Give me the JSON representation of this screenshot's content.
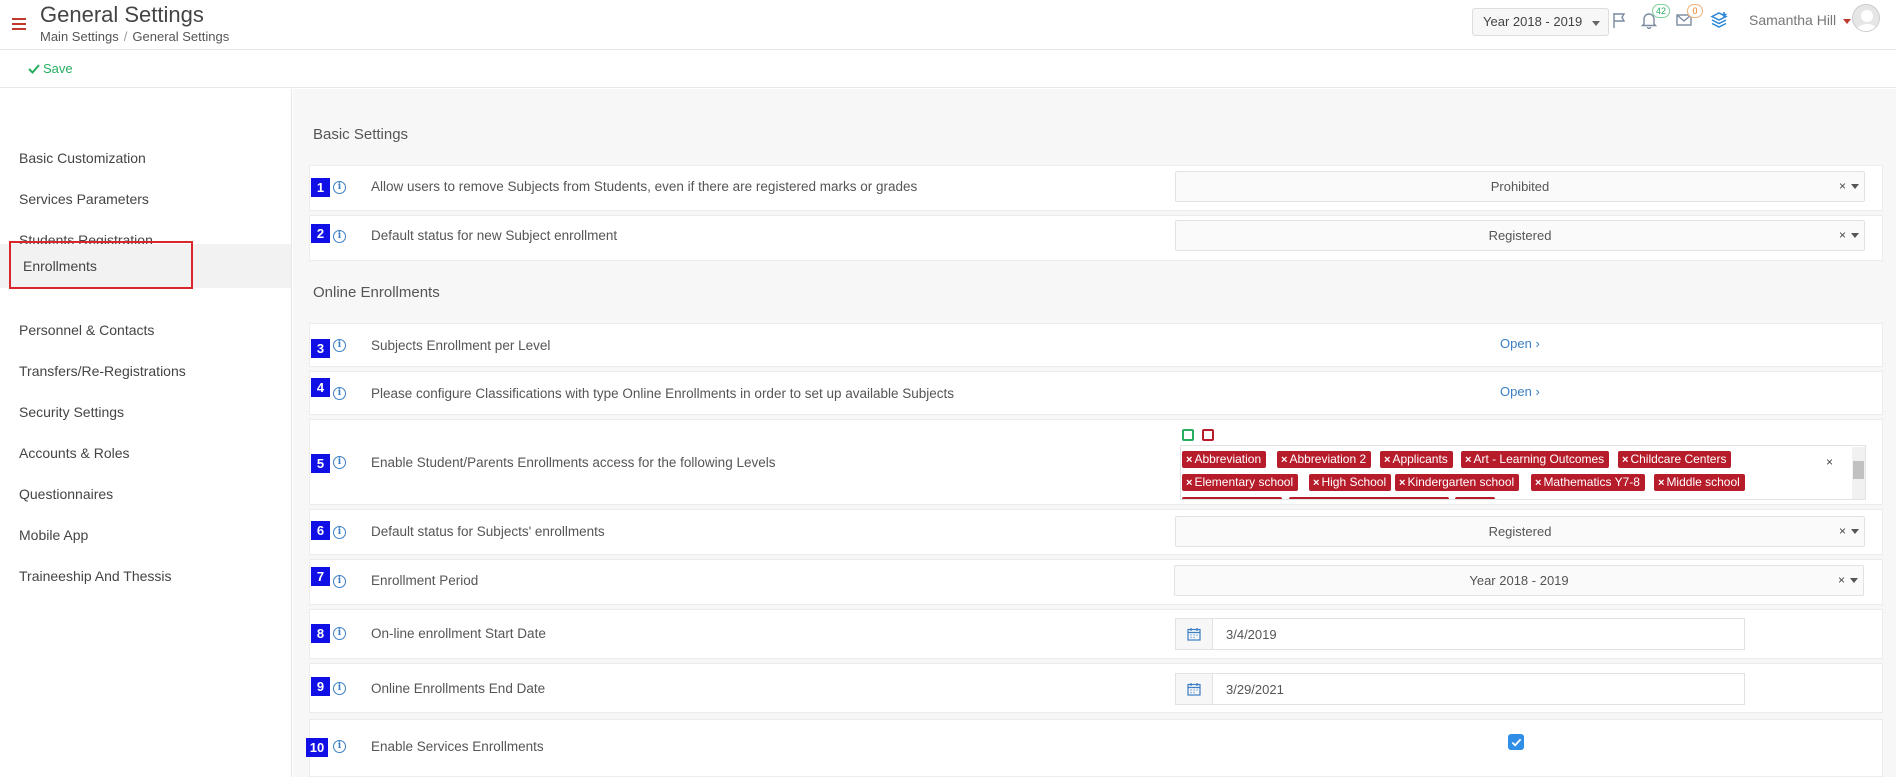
{
  "header": {
    "title": "General Settings",
    "breadcrumb": [
      "Main Settings",
      "General Settings"
    ],
    "year_selector": "Year 2018 - 2019",
    "notifications_count": "42",
    "messages_count": "0",
    "user_name": "Samantha Hill"
  },
  "toolbar": {
    "save_label": "Save"
  },
  "sidebar": {
    "items": [
      {
        "label": "Basic Customization"
      },
      {
        "label": "Services Parameters"
      },
      {
        "label": "Students Registration"
      },
      {
        "label": "Enrollments",
        "active": true
      },
      {
        "label": "Personnel & Contacts"
      },
      {
        "label": "Transfers/Re-Registrations"
      },
      {
        "label": "Security Settings"
      },
      {
        "label": "Accounts & Roles"
      },
      {
        "label": "Questionnaires"
      },
      {
        "label": "Mobile App"
      },
      {
        "label": "Traineeship And Thessis"
      }
    ]
  },
  "main": {
    "basic_title": "Basic Settings",
    "online_title": "Online Enrollments",
    "settings": [
      {
        "num": "1",
        "label": "Allow users to remove Subjects from Students, even if there are registered marks or grades",
        "value": "Prohibited"
      },
      {
        "num": "2",
        "label": "Default status for new Subject enrollment",
        "value": "Registered"
      },
      {
        "num": "3",
        "label": "Subjects Enrollment per Level",
        "value": "Open"
      },
      {
        "num": "4",
        "label": "Please configure Classifications with type Online Enrollments in order to set up available Subjects",
        "value": "Open"
      },
      {
        "num": "5",
        "label": "Enable Student/Parents Enrollments access for the following Levels",
        "tags": [
          "Abbreviation",
          "Abbreviation 2",
          "Applicants",
          "Art - Learning Outcomes",
          "Childcare Centers",
          "Elementary school",
          "High School",
          "Kindergarten school",
          "Mathematics Y7-8",
          "Middle school"
        ]
      },
      {
        "num": "6",
        "label": "Default status for Subjects' enrollments",
        "value": "Registered"
      },
      {
        "num": "7",
        "label": "Enrollment Period",
        "value": "Year 2018 - 2019"
      },
      {
        "num": "8",
        "label": "On-line enrollment Start Date",
        "value": "3/4/2019"
      },
      {
        "num": "9",
        "label": "Online Enrollments End Date",
        "value": "3/29/2021"
      },
      {
        "num": "10",
        "label": "Enable Services Enrollments",
        "checked": true
      }
    ]
  },
  "colors": {
    "accent_red": "#c0392b",
    "tag_red": "#b71c2b",
    "number_badge": "#1010e6",
    "link_blue": "#3b7fc4",
    "save_green": "#27ae60"
  }
}
